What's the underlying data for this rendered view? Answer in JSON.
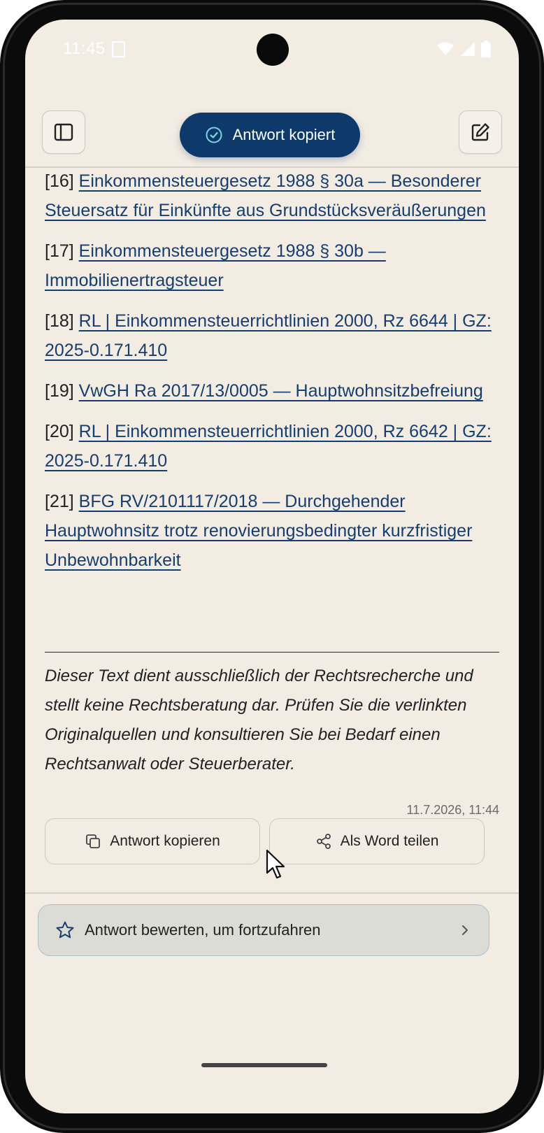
{
  "status_bar": {
    "time": "11:45"
  },
  "header": {
    "sidebar_icon": "sidebar-toggle-icon",
    "edit_icon": "edit-icon",
    "toast": {
      "label": "Antwort kopiert",
      "icon": "check-circle-icon"
    }
  },
  "references": [
    {
      "number": "[16]",
      "title": "Einkommensteuergesetz 1988 § 30a — Besonderer Steuersatz für Einkünfte aus Grundstücksveräußerungen"
    },
    {
      "number": "[17]",
      "title": "Einkommensteuergesetz 1988 § 30b — Immobilienertragsteuer"
    },
    {
      "number": "[18]",
      "title": "RL | Einkommensteuerrichtlinien 2000, Rz 6644 | GZ: 2025-0.171.410"
    },
    {
      "number": "[19]",
      "title": "VwGH Ra 2017/13/0005 — Hauptwohnsitzbefreiung"
    },
    {
      "number": "[20]",
      "title": "RL | Einkommensteuerrichtlinien 2000, Rz 6642 | GZ: 2025-0.171.410"
    },
    {
      "number": "[21]",
      "title": "BFG RV/2101117/2018 — Durchgehender Hauptwohnsitz trotz renovierungsbedingter kurzfristiger Unbewohnbarkeit"
    }
  ],
  "disclaimer": "Dieser Text dient ausschließlich der Rechtsrecherche und stellt keine Rechtsberatung dar. Prüfen Sie die verlinkten Originalquellen und konsultieren Sie bei Bedarf einen Rechtsanwalt oder Steuerberater.",
  "timestamp": "11.7.2026, 11:44",
  "actions": {
    "copy_label": "Antwort kopieren",
    "share_label": "Als Word teilen"
  },
  "rate": {
    "label": "Antwort bewerten, um fortzufahren"
  },
  "colors": {
    "background": "#f2ece3",
    "accent": "#0e3a6b",
    "link": "#173e6e"
  }
}
